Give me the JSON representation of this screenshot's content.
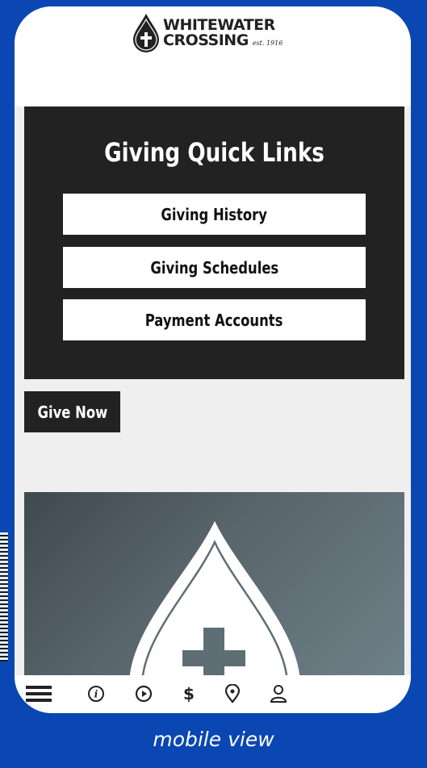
{
  "brand": {
    "name_line1": "WHITEWATER",
    "name_line2": "CROSSING",
    "established": "est. 1916"
  },
  "quick_links": {
    "title": "Giving Quick Links",
    "buttons": [
      {
        "label": "Giving History"
      },
      {
        "label": "Giving Schedules"
      },
      {
        "label": "Payment Accounts"
      }
    ]
  },
  "give_now": {
    "label": "Give Now"
  },
  "bottom_nav": {
    "icons": [
      "menu-icon",
      "info-icon",
      "play-icon",
      "dollar-icon",
      "location-pin-icon",
      "user-icon"
    ],
    "dollar_glyph": "$"
  },
  "caption": "mobile view",
  "colors": {
    "background": "#0a47b3",
    "panel_dark": "#222222",
    "page_bg": "#efefef",
    "button_bg": "#ffffff"
  }
}
